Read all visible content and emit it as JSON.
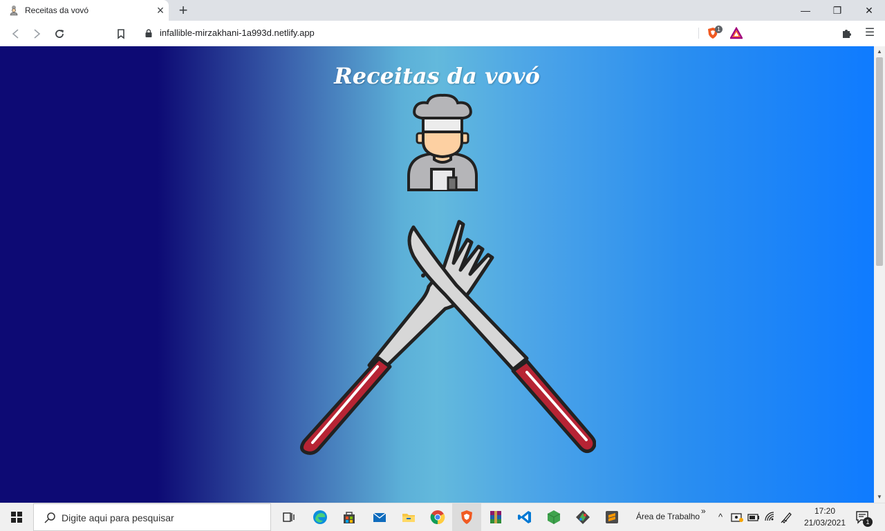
{
  "browser": {
    "tab_title": "Receitas da vovó",
    "tab_close": "×",
    "new_tab": "+",
    "url": "infallible-mirzakhani-1a993d.netlify.app",
    "shield_count": "1",
    "window_controls": {
      "minimize": "—",
      "maximize": "❐",
      "close": "✕"
    },
    "nav_icons": {
      "back": "back-arrow-icon",
      "forward": "forward-arrow-icon",
      "reload": "reload-icon",
      "bookmark": "bookmark-icon"
    }
  },
  "page": {
    "title": "Receitas da vovó",
    "images": [
      "chef-illustration",
      "crossed-fork-and-knife-illustration"
    ],
    "colors": {
      "gradient_left": "#0d0a74",
      "gradient_center": "#63b9dc",
      "gradient_right": "#0f7bff",
      "handle_red": "#b72434"
    }
  },
  "taskbar": {
    "search_placeholder": "Digite aqui para pesquisar",
    "desktop_label": "Área de Trabalho",
    "time": "17:20",
    "date": "21/03/2021",
    "notification_count": "1",
    "apps": [
      "task-view",
      "edge",
      "store",
      "mail",
      "file-explorer",
      "chrome",
      "brave",
      "winrar",
      "vscode",
      "cube-app",
      "git",
      "sublime-text"
    ]
  }
}
